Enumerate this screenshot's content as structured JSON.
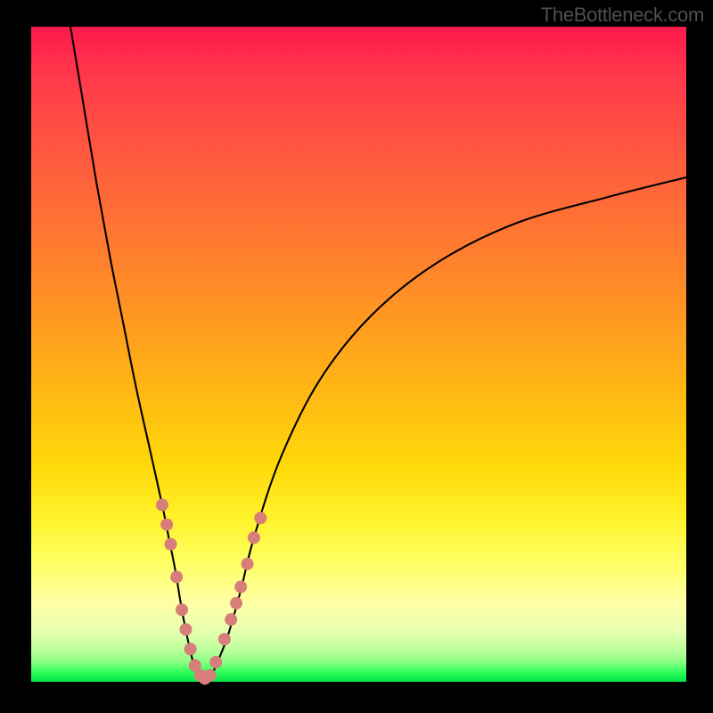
{
  "watermark": "TheBottleneck.com",
  "chart_data": {
    "type": "line",
    "title": "",
    "xlabel": "",
    "ylabel": "",
    "xlim": [
      0,
      100
    ],
    "ylim": [
      0,
      100
    ],
    "grid": false,
    "series": [
      {
        "name": "bottleneck-curve",
        "x": [
          6,
          8,
          10,
          12,
          14,
          16,
          18,
          20,
          21,
          22,
          23,
          24,
          25,
          26,
          27,
          28,
          30,
          32,
          34,
          38,
          44,
          52,
          62,
          74,
          88,
          100
        ],
        "y": [
          100,
          88,
          76,
          65,
          55,
          45,
          36,
          27,
          22,
          17,
          11,
          6,
          2,
          0,
          0,
          2,
          7,
          14,
          22,
          34,
          46,
          56,
          64,
          70,
          74,
          77
        ]
      }
    ],
    "markers": {
      "name": "highlight-dots",
      "color": "#d77d7a",
      "points": [
        {
          "x": 20.0,
          "y": 27
        },
        {
          "x": 20.7,
          "y": 24
        },
        {
          "x": 21.3,
          "y": 21
        },
        {
          "x": 22.2,
          "y": 16
        },
        {
          "x": 23.0,
          "y": 11
        },
        {
          "x": 23.6,
          "y": 8
        },
        {
          "x": 24.3,
          "y": 5
        },
        {
          "x": 25.0,
          "y": 2.5
        },
        {
          "x": 25.8,
          "y": 1
        },
        {
          "x": 26.5,
          "y": 0.5
        },
        {
          "x": 27.3,
          "y": 1
        },
        {
          "x": 28.2,
          "y": 3
        },
        {
          "x": 29.5,
          "y": 6.5
        },
        {
          "x": 30.5,
          "y": 9.5
        },
        {
          "x": 31.3,
          "y": 12
        },
        {
          "x": 32.0,
          "y": 14.5
        },
        {
          "x": 33.0,
          "y": 18
        },
        {
          "x": 34.0,
          "y": 22
        },
        {
          "x": 35.0,
          "y": 25
        }
      ]
    }
  }
}
